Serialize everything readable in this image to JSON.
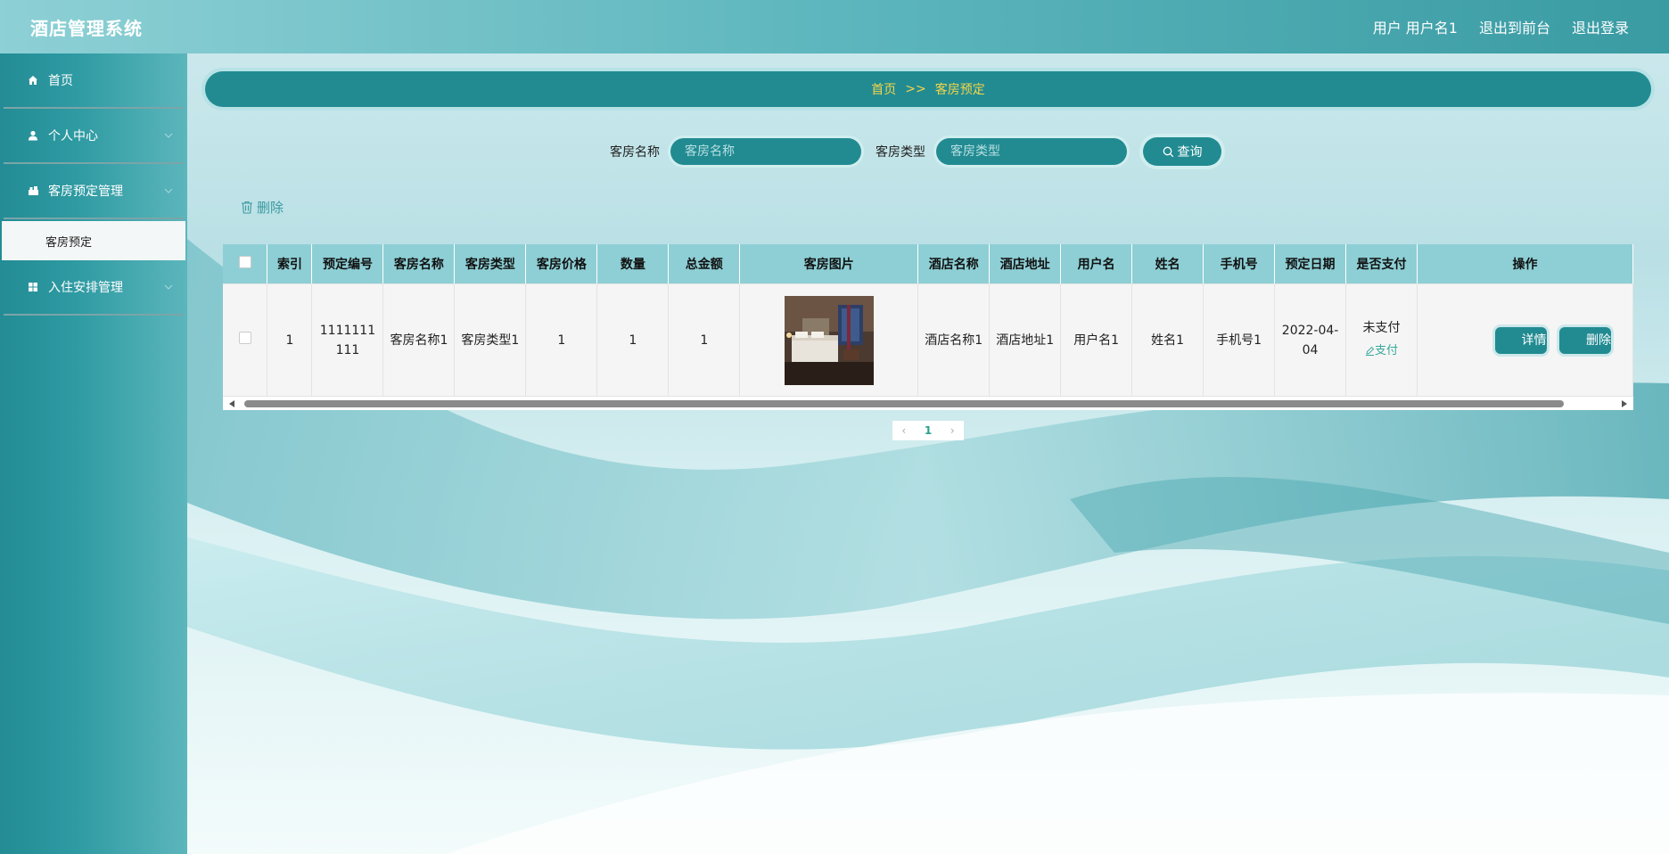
{
  "header": {
    "title": "酒店管理系统",
    "user_label": "用户 用户名1",
    "back_to_front": "退出到前台",
    "logout": "退出登录"
  },
  "sidebar": {
    "items": [
      {
        "label": "首页",
        "icon": "home-icon"
      },
      {
        "label": "个人中心",
        "icon": "user-icon"
      },
      {
        "label": "客房预定管理",
        "icon": "booking-icon"
      },
      {
        "label": "入住安排管理",
        "icon": "grid-icon"
      }
    ],
    "sub_item": "客房预定"
  },
  "breadcrumb": {
    "home": "首页",
    "separator": ">>",
    "current": "客房预定"
  },
  "search": {
    "room_name_label": "客房名称",
    "room_name_placeholder": "客房名称",
    "room_type_label": "客房类型",
    "room_type_placeholder": "客房类型",
    "query_label": "查询"
  },
  "toolbar": {
    "delete_label": "删除"
  },
  "table": {
    "columns": [
      "索引",
      "预定编号",
      "客房名称",
      "客房类型",
      "客房价格",
      "数量",
      "总金额",
      "客房图片",
      "酒店名称",
      "酒店地址",
      "用户名",
      "姓名",
      "手机号",
      "预定日期",
      "是否支付",
      "操作"
    ],
    "rows": [
      {
        "index": "1",
        "booking_no": "1111111111",
        "room_name": "客房名称1",
        "room_type": "客房类型1",
        "room_price": "1",
        "quantity": "1",
        "total": "1",
        "hotel_name": "酒店名称1",
        "hotel_address": "酒店地址1",
        "username": "用户名1",
        "name": "姓名1",
        "phone": "手机号1",
        "date": "2022-04-04",
        "paid_status": "未支付",
        "pay_action": "支付",
        "detail_button": "详情",
        "delete_button": "删除"
      }
    ]
  },
  "pagination": {
    "current_page": "1"
  },
  "colors": {
    "primary": "#228b92",
    "header_cell": "#8dcfd5",
    "breadcrumb_text": "#f3d54a",
    "pay_link": "#36a89a"
  }
}
